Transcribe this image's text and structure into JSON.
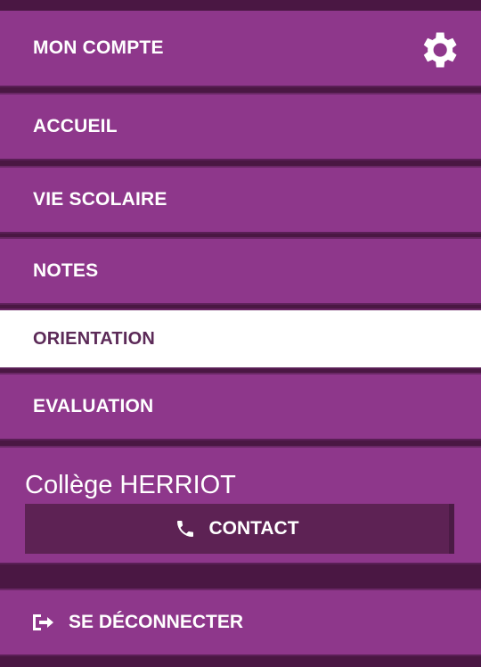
{
  "menu": {
    "account": "MON COMPTE",
    "home": "ACCUEIL",
    "school_life": "VIE SCOLAIRE",
    "grades": "NOTES",
    "orientation": "ORIENTATION",
    "evaluation": "EVALUATION"
  },
  "active_item": "orientation",
  "school": {
    "name": "Collège HERRIOT",
    "contact_label": "CONTACT"
  },
  "logout_label": "SE DÉCONNECTER",
  "icons": {
    "settings": "gear-icon",
    "contact": "phone-icon",
    "logout": "logout-icon"
  },
  "colors": {
    "menu_bg": "#8e378b",
    "active_bg": "#ffffff",
    "active_text": "#5c2a58",
    "contact_bg": "#5d2254",
    "separator": "#4a1743"
  }
}
